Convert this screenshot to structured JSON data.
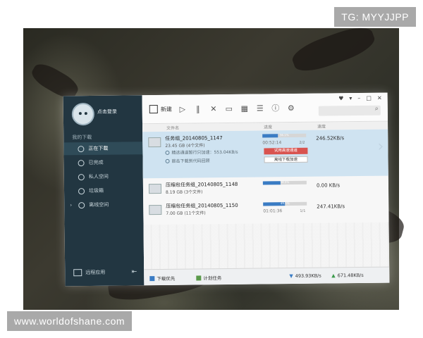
{
  "watermarks": {
    "top_right": "TG: MYYJJPP",
    "bottom_left": "www.worldofshane.com"
  },
  "sidebar": {
    "login": "点击登录",
    "heading": "我的下载",
    "items": [
      {
        "label": "正在下载",
        "icon": "download-icon",
        "active": true
      },
      {
        "label": "已完成",
        "icon": "check-icon",
        "active": false
      },
      {
        "label": "私人空间",
        "icon": "lock-icon",
        "active": false
      },
      {
        "label": "垃圾箱",
        "icon": "trash-icon",
        "active": false
      },
      {
        "label": "离线空间",
        "icon": "cloud-icon",
        "active": false
      }
    ],
    "footer_label": "远程应用"
  },
  "toolbar": {
    "new_label": "新建",
    "buttons": [
      "play-icon",
      "pause-icon",
      "close-icon",
      "folder-icon",
      "grid-icon",
      "list-icon",
      "info-icon",
      "settings-icon"
    ],
    "window_controls": [
      "skin-icon",
      "menu-icon",
      "minimize-icon",
      "maximize-icon",
      "close-icon"
    ]
  },
  "columns": {
    "name": "文件名",
    "progress": "进度",
    "speed": "速度"
  },
  "downloads": [
    {
      "name": "任务组_20140805_1147",
      "size": "23.45 GB",
      "count": "(4个文件)",
      "progress": 0.361,
      "progress_label": "36.1%",
      "eta": "00:52:14",
      "frac": "2/2",
      "speed": "246.52KB/s",
      "line1": "精选通道暂行只加速：553.04KB/s",
      "line2": "敲击下载到代码回顾",
      "btn_red": "试用高速通道",
      "btn_white": "离线下载加速"
    },
    {
      "name": "压缩包任务组_20140805_1148",
      "size": "8.19 GB",
      "count": "(3个文件)",
      "progress": 0.4,
      "progress_label": "38.5%",
      "speed": "0.00 KB/s"
    },
    {
      "name": "压缩包任务组_20140805_1150",
      "size": "7.00 GB",
      "count": "(11个文件)",
      "progress": 0.5,
      "progress_label": "49.5%",
      "eta": "01:01:36",
      "frac": "1/1",
      "speed": "247.41KB/s"
    }
  ],
  "statusbar": {
    "download_first": "下载优先",
    "plan": "计划任务",
    "down_speed": "493.93KB/s",
    "up_speed": "671.48KB/s"
  },
  "colors": {
    "sidebar_bg": "#223641",
    "selected_row": "#cfe3f1",
    "accent": "#3a7cc4",
    "danger": "#d9534f"
  }
}
